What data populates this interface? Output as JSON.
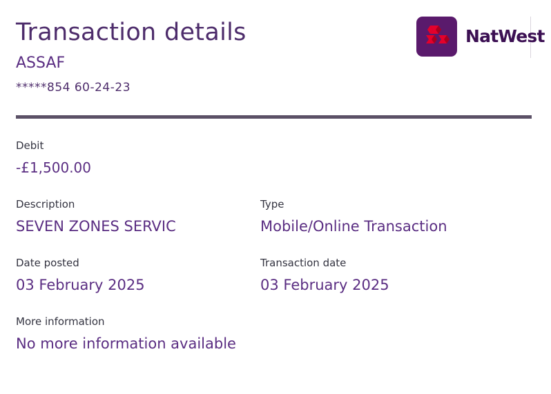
{
  "header": {
    "title": "Transaction details",
    "account_name": "ASSAF",
    "account_number": "*****854 60-24-23"
  },
  "brand": {
    "name": "NatWest",
    "logo_icon": "natwest-cubes-logo",
    "colors": {
      "primary": "#5a1a6c",
      "red": "#e5002b",
      "text": "#3c1053"
    }
  },
  "transaction": {
    "debit_label": "Debit",
    "debit_value": "-£1,500.00",
    "description_label": "Description",
    "description_value": "SEVEN ZONES SERVIC",
    "type_label": "Type",
    "type_value": "Mobile/Online Transaction",
    "date_posted_label": "Date posted",
    "date_posted_value": "03 February 2025",
    "transaction_date_label": "Transaction date",
    "transaction_date_value": "03 February 2025",
    "more_info_label": "More information",
    "more_info_value": "No more information available"
  }
}
